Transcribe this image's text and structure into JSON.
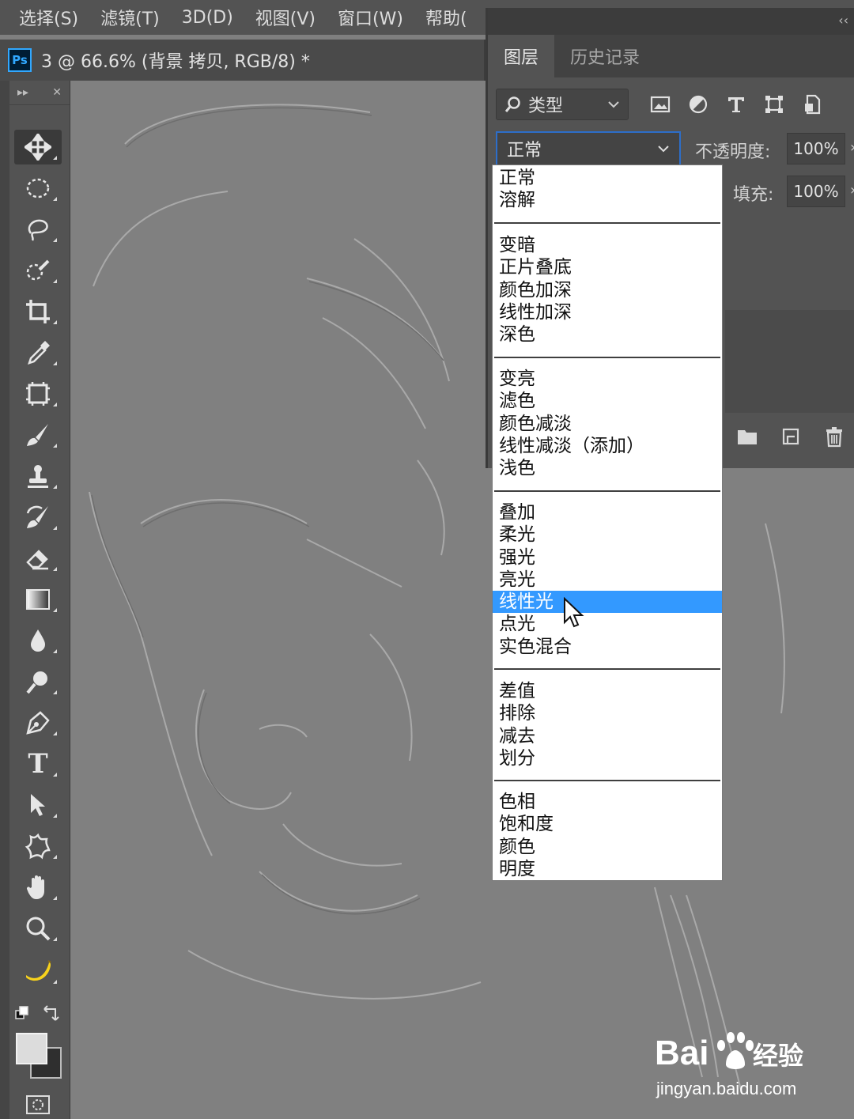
{
  "menu_bar": {
    "items": [
      "选择(S)",
      "滤镜(T)",
      "3D(D)",
      "视图(V)",
      "窗口(W)",
      "帮助("
    ]
  },
  "document_tab": {
    "app_badge": "Ps",
    "title": "3 @ 66.6% (背景 拷贝, RGB/8) *"
  },
  "toolbar": {
    "expand_glyph": "▸▸",
    "close_glyph": "✕",
    "tools": [
      "move-tool-icon",
      "elliptical-marquee-icon",
      "lasso-icon",
      "quick-selection-icon",
      "crop-icon",
      "eyedropper-icon",
      "frame-tool-icon",
      "brush-icon",
      "clone-stamp-icon",
      "history-brush-icon",
      "eraser-icon",
      "gradient-icon",
      "blur-drop-icon",
      "dodge-icon",
      "pen-icon",
      "type-icon",
      "path-selection-icon",
      "custom-shape-icon",
      "hand-icon",
      "zoom-icon",
      "banana-icon"
    ],
    "type_tool_glyph": "T"
  },
  "layers_panel": {
    "collapse_glyph": "‹‹",
    "tabs": [
      {
        "label": "图层",
        "active": true
      },
      {
        "label": "历史记录",
        "active": false
      }
    ],
    "filter": {
      "label": "类型",
      "icons": [
        "image-filter-icon",
        "adjustment-filter-icon",
        "type-filter-icon",
        "shape-filter-icon",
        "smart-object-filter-icon"
      ]
    },
    "blend_mode": "正常",
    "opacity_label": "不透明度:",
    "opacity_value": "100%",
    "fill_label": "填充:",
    "fill_value": "100%",
    "footer_icons": [
      "new-group-icon",
      "new-layer-icon",
      "trash-icon"
    ]
  },
  "blend_dropdown": {
    "selected": "线性光",
    "groups": [
      [
        "正常",
        "溶解"
      ],
      [
        "变暗",
        "正片叠底",
        "颜色加深",
        "线性加深",
        "深色"
      ],
      [
        "变亮",
        "滤色",
        "颜色减淡",
        "线性减淡（添加）",
        "浅色"
      ],
      [
        "叠加",
        "柔光",
        "强光",
        "亮光",
        "线性光",
        "点光",
        "实色混合"
      ],
      [
        "差值",
        "排除",
        "减去",
        "划分"
      ],
      [
        "色相",
        "饱和度",
        "颜色",
        "明度"
      ]
    ]
  },
  "watermark": {
    "brand": "Bai",
    "brand_suffix": "经验",
    "url": "jingyan.baidu.com"
  },
  "colors": {
    "selection_blue": "#3399ff",
    "focus_border": "#2d6ec9",
    "ps_blue": "#31a8ff"
  }
}
